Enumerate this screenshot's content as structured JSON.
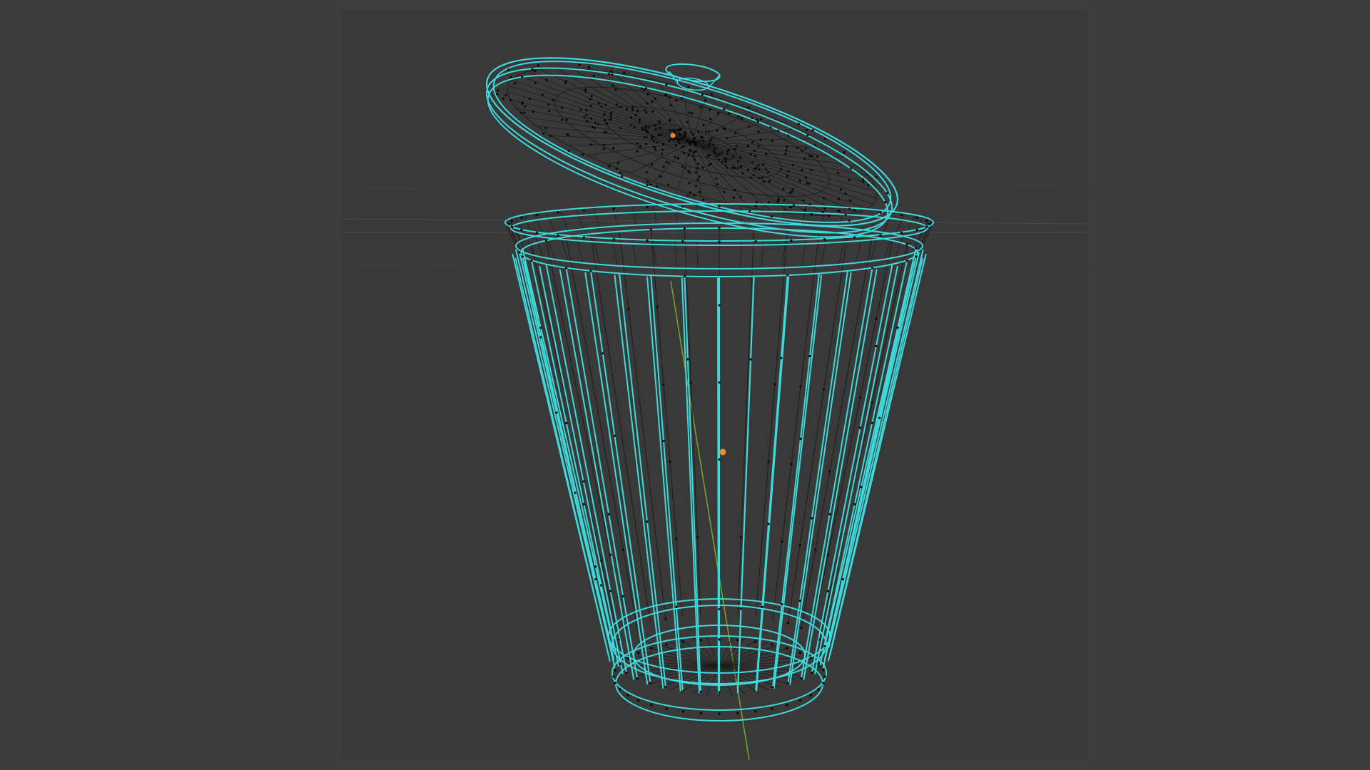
{
  "viewport": {
    "mode": "wireframe",
    "object": "trash-can",
    "colors": {
      "page_background": "#3d3d3d",
      "viewport_background": "#393939",
      "selected_wire": "#3fd9dc",
      "unselected_wire": "#1d1d1d",
      "vertex": "#0a0a0a",
      "origin": "#f08a2a",
      "z_axis": "#7ba42a",
      "grid_line": "#4a4a4a"
    },
    "origins": [
      "lid-origin",
      "body-origin"
    ]
  }
}
